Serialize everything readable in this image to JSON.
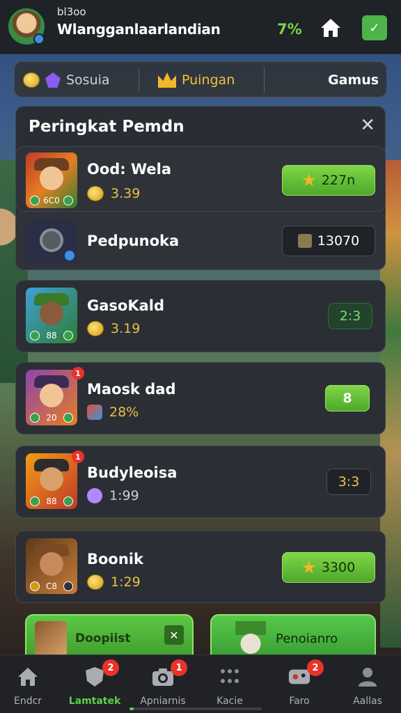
{
  "header": {
    "username_small": "bl3oo",
    "username": "Wlangganlaarlandian",
    "percent": "7%",
    "icons": [
      "home-icon",
      "check-icon"
    ]
  },
  "tabs": [
    {
      "label": "Sosuia",
      "icons": [
        "coin-icon",
        "gem-icon"
      ]
    },
    {
      "label": "Puingan",
      "icons": [
        "crown-icon"
      ]
    },
    {
      "label": "Gamus"
    }
  ],
  "leaderboard": {
    "title": "Peringkat Pemdn",
    "close_icon": "close-icon"
  },
  "players": [
    {
      "name": "Ood: Wela",
      "score": "3.39",
      "thumb_stat": "6C0",
      "pill": "227n",
      "pill_style": "green-star"
    },
    {
      "name": "Pedpunoka",
      "score": "",
      "thumb_stat": "",
      "pill": "13070",
      "pill_style": "dark-shield"
    },
    {
      "name": "GasoKald",
      "score": "3.19",
      "thumb_stat": "88",
      "pill": "2:3",
      "pill_style": "darkgreen"
    },
    {
      "name": "Maosk dad",
      "score": "28%",
      "thumb_stat": "20",
      "pill": "8",
      "pill_style": "green"
    },
    {
      "name": "Budyleoisa",
      "score": "1:99",
      "thumb_stat": "88",
      "pill": "3:3",
      "pill_style": "dark"
    },
    {
      "name": "Boonik",
      "score": "1:29",
      "thumb_stat": "C8",
      "pill": "3300",
      "pill_style": "green-star"
    }
  ],
  "cards": [
    {
      "label": "Doopiist",
      "icon": "close-icon"
    },
    {
      "label": "Penoianro"
    }
  ],
  "bottom_nav": [
    {
      "label": "Endcr",
      "icon": "home-icon",
      "badge": ""
    },
    {
      "label": "Lamtatek",
      "icon": "shield-icon",
      "badge": "2",
      "active": true
    },
    {
      "label": "Apniarnis",
      "icon": "camera-icon",
      "badge": "1"
    },
    {
      "label": "Kacie",
      "icon": "grid-icon",
      "badge": ""
    },
    {
      "label": "Faro",
      "icon": "gamepad-icon",
      "badge": "2"
    },
    {
      "label": "Aallas",
      "icon": "user-icon",
      "badge": ""
    }
  ],
  "colors": {
    "accent": "#5ed04a",
    "panel": "#2a2d33",
    "badge": "#e8332a"
  }
}
